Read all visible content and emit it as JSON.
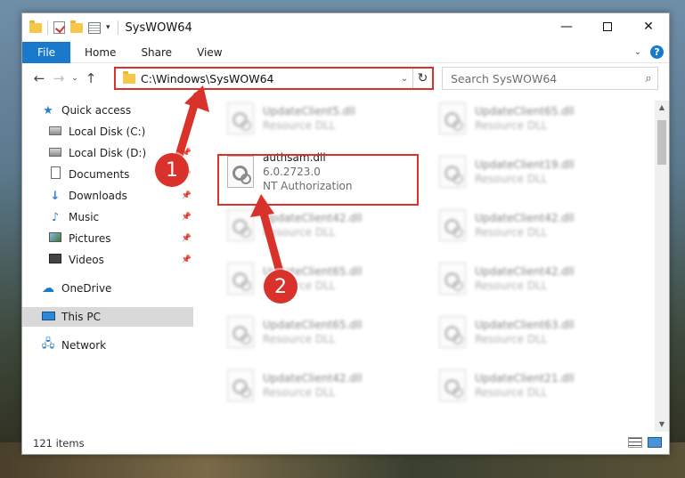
{
  "window": {
    "title": "SysWOW64",
    "controls": {
      "minimize": "—",
      "maximize": "",
      "close": "✕"
    }
  },
  "qat": {
    "dropdown": "▾"
  },
  "ribbon": {
    "tabs": [
      "File",
      "Home",
      "Share",
      "View"
    ],
    "expand": "⌄",
    "help": "?"
  },
  "nav": {
    "back": "←",
    "forward": "→",
    "recent": "⌄",
    "up": "↑",
    "address": "C:\\Windows\\SysWOW64",
    "address_dropdown": "⌄",
    "refresh": "↻",
    "search_placeholder": "Search SysWOW64",
    "search_icon": "⌕"
  },
  "sidebar": {
    "items": [
      {
        "label": "Quick access",
        "icon": "star-icon",
        "pinned": false
      },
      {
        "label": "Local Disk (C:)",
        "icon": "disk-icon",
        "pinned": true
      },
      {
        "label": "Local Disk (D:)",
        "icon": "disk-icon",
        "pinned": true
      },
      {
        "label": "Documents",
        "icon": "documents-icon",
        "pinned": true
      },
      {
        "label": "Downloads",
        "icon": "downloads-icon",
        "pinned": true
      },
      {
        "label": "Music",
        "icon": "music-icon",
        "pinned": true
      },
      {
        "label": "Pictures",
        "icon": "pictures-icon",
        "pinned": true
      },
      {
        "label": "Videos",
        "icon": "videos-icon",
        "pinned": true
      },
      {
        "label": "OneDrive",
        "icon": "onedrive-icon",
        "pinned": false
      },
      {
        "label": "This PC",
        "icon": "this-pc-icon",
        "pinned": false,
        "selected": true
      },
      {
        "label": "Network",
        "icon": "network-icon",
        "pinned": false
      }
    ]
  },
  "files": {
    "highlighted": {
      "name": "authsam.dll",
      "version": "6.0.2723.0",
      "description": "NT Authorization"
    },
    "blurred_left": [
      {
        "name": "UpdateClient5.dll",
        "type": "Resource DLL"
      },
      {
        "name": "UpdateClient42.dll",
        "type": "Resource DLL"
      },
      {
        "name": "UpdateClient65.dll",
        "type": "Resource DLL"
      },
      {
        "name": "UpdateClient65.dll",
        "type": "Resource DLL"
      },
      {
        "name": "UpdateClient42.dll",
        "type": "Resource DLL"
      }
    ],
    "blurred_right": [
      {
        "name": "UpdateClient65.dll",
        "type": "Resource DLL"
      },
      {
        "name": "UpdateClient19.dll",
        "type": "Resource DLL"
      },
      {
        "name": "UpdateClient42.dll",
        "type": "Resource DLL"
      },
      {
        "name": "UpdateClient42.dll",
        "type": "Resource DLL"
      },
      {
        "name": "UpdateClient63.dll",
        "type": "Resource DLL"
      },
      {
        "name": "UpdateClient21.dll",
        "type": "Resource DLL"
      }
    ]
  },
  "status": {
    "item_count": "121 items"
  },
  "scroll": {
    "up": "▲",
    "down": "▼"
  },
  "annotations": {
    "step1": "1",
    "step2": "2",
    "accent_color": "#d9322b"
  }
}
